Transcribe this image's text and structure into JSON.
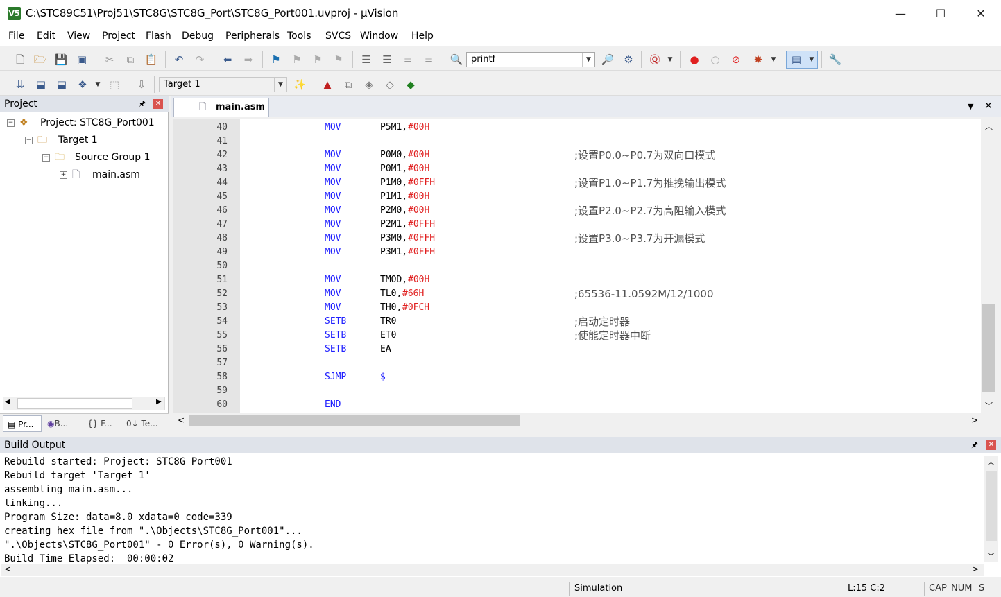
{
  "window": {
    "title": "C:\\STC89C51\\Proj51\\STC8G\\STC8G_Port\\STC8G_Port001.uvproj - µVision",
    "app_icon": "V5",
    "minimize": "—",
    "maximize": "☐",
    "close": "✕"
  },
  "menu": [
    "File",
    "Edit",
    "View",
    "Project",
    "Flash",
    "Debug",
    "Peripherals",
    "Tools",
    "SVCS",
    "Window",
    "Help"
  ],
  "toolbar1": {
    "find_value": "printf"
  },
  "toolbar2": {
    "target_value": "Target 1"
  },
  "project_panel": {
    "title": "Project",
    "pin": "🖈",
    "close": "✕",
    "tree": {
      "project": "Project: STC8G_Port001",
      "target": "Target 1",
      "group": "Source Group 1",
      "file": "main.asm"
    },
    "bottom_tabs": [
      "Pr...",
      "B...",
      "{} F...",
      "0↓ Te..."
    ]
  },
  "editor": {
    "tab": "main.asm",
    "lines": [
      {
        "n": "40",
        "op": "MOV",
        "arg1": "P5M1,",
        "arg2": "#00H",
        "cmt": ""
      },
      {
        "n": "41",
        "op": "",
        "arg1": "",
        "arg2": "",
        "cmt": ""
      },
      {
        "n": "42",
        "op": "MOV",
        "arg1": "P0M0,",
        "arg2": "#00H",
        "cmt": ";设置P0.0~P0.7为双向口模式"
      },
      {
        "n": "43",
        "op": "MOV",
        "arg1": "P0M1,",
        "arg2": "#00H",
        "cmt": ""
      },
      {
        "n": "44",
        "op": "MOV",
        "arg1": "P1M0,",
        "arg2": "#0FFH",
        "cmt": ";设置P1.0~P1.7为推挽输出模式"
      },
      {
        "n": "45",
        "op": "MOV",
        "arg1": "P1M1,",
        "arg2": "#00H",
        "cmt": ""
      },
      {
        "n": "46",
        "op": "MOV",
        "arg1": "P2M0,",
        "arg2": "#00H",
        "cmt": ";设置P2.0~P2.7为高阻输入模式"
      },
      {
        "n": "47",
        "op": "MOV",
        "arg1": "P2M1,",
        "arg2": "#0FFH",
        "cmt": ""
      },
      {
        "n": "48",
        "op": "MOV",
        "arg1": "P3M0,",
        "arg2": "#0FFH",
        "cmt": ";设置P3.0~P3.7为开漏模式"
      },
      {
        "n": "49",
        "op": "MOV",
        "arg1": "P3M1,",
        "arg2": "#0FFH",
        "cmt": ""
      },
      {
        "n": "50",
        "op": "",
        "arg1": "",
        "arg2": "",
        "cmt": ""
      },
      {
        "n": "51",
        "op": "MOV",
        "arg1": "TMOD,",
        "arg2": "#00H",
        "cmt": ""
      },
      {
        "n": "52",
        "op": "MOV",
        "arg1": "TL0,",
        "arg2": "#66H",
        "cmt": ";65536-11.0592M/12/1000"
      },
      {
        "n": "53",
        "op": "MOV",
        "arg1": "TH0,",
        "arg2": "#0FCH",
        "cmt": ""
      },
      {
        "n": "54",
        "op": "SETB",
        "arg1": "TR0",
        "arg2": "",
        "cmt": ";启动定时器"
      },
      {
        "n": "55",
        "op": "SETB",
        "arg1": "ET0",
        "arg2": "",
        "cmt": ";使能定时器中断"
      },
      {
        "n": "56",
        "op": "SETB",
        "arg1": "EA",
        "arg2": "",
        "cmt": ""
      },
      {
        "n": "57",
        "op": "",
        "arg1": "",
        "arg2": "",
        "cmt": ""
      },
      {
        "n": "58",
        "op": "SJMP",
        "arg1": "$",
        "arg2": "",
        "cmt": ""
      },
      {
        "n": "59",
        "op": "",
        "arg1": "",
        "arg2": "",
        "cmt": ""
      },
      {
        "n": "60",
        "op": "END",
        "arg1": "",
        "arg2": "",
        "cmt": ""
      }
    ]
  },
  "build_output": {
    "title": "Build Output",
    "lines": [
      "Rebuild started: Project: STC8G_Port001",
      "Rebuild target 'Target 1'",
      "assembling main.asm...",
      "linking...",
      "Program Size: data=8.0 xdata=0 code=339",
      "creating hex file from \".\\Objects\\STC8G_Port001\"...",
      "\".\\Objects\\STC8G_Port001\" - 0 Error(s), 0 Warning(s).",
      "Build Time Elapsed:  00:00:02"
    ]
  },
  "status": {
    "mode": "Simulation",
    "position": "L:15 C:2",
    "cap": "CAP",
    "num": "NUM",
    "scrl": "S"
  }
}
